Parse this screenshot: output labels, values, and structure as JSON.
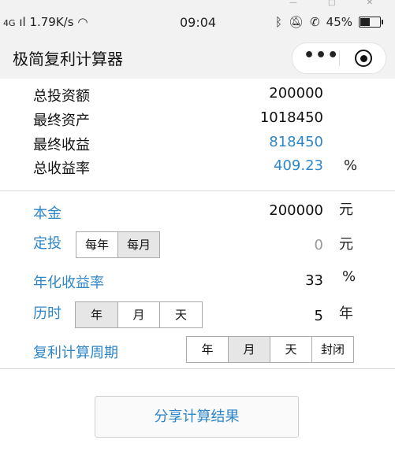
{
  "status_bar": {
    "signal": "4G",
    "speed": "1.79K/s",
    "time": "09:04",
    "battery": "45%"
  },
  "nav": {
    "title": "极简复利计算器",
    "menu_dots": "•••"
  },
  "results": [
    {
      "label": "总投资额",
      "value": "200000",
      "unit": ""
    },
    {
      "label": "最终资产",
      "value": "1018450",
      "unit": ""
    },
    {
      "label": "最终收益",
      "value": "818450",
      "unit": ""
    },
    {
      "label": "总收益率",
      "value": "409.23",
      "unit": "%"
    }
  ],
  "inputs": {
    "principal": {
      "label": "本金",
      "value": "200000",
      "unit": "元"
    },
    "regular": {
      "label": "定投",
      "options": [
        "每年",
        "每月"
      ],
      "selected": "每月",
      "value": "0",
      "unit": "元"
    },
    "rate": {
      "label": "年化收益率",
      "value": "33",
      "unit": "%"
    },
    "duration": {
      "label": "历时",
      "options": [
        "年",
        "月",
        "天"
      ],
      "selected": "年",
      "value": "5",
      "unit": "年"
    },
    "period": {
      "label": "复利计算周期",
      "options": [
        "年",
        "月",
        "天",
        "封闭"
      ],
      "selected": "月"
    }
  },
  "share_button": "分享计算结果",
  "colors": {
    "accent": "#2e86c9",
    "bar_bg": "#f2f2f2",
    "selected_bg": "#e6e6e6"
  }
}
